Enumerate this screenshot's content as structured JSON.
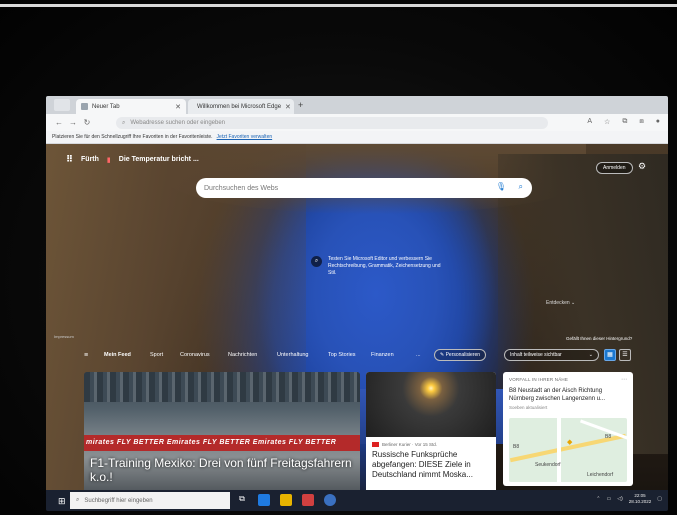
{
  "browser": {
    "tabs": [
      {
        "label": "Neuer Tab",
        "active": true
      },
      {
        "label": "Willkommen bei Microsoft Edge",
        "active": false
      }
    ],
    "address_placeholder": "Webadresse suchen oder eingeben",
    "favorites_bar_text": "Platzieren Sie für den Schnellzugriff Ihre Favoriten in der Favoritenleiste.",
    "favorites_bar_link": "Jetzt Favoriten verwalten"
  },
  "newtab": {
    "location": "Fürth",
    "weather": "Die Temperatur bricht ...",
    "signin_label": "Anmelden",
    "search_placeholder": "Durchsuchen des Webs",
    "promo_text": "Testen Sie Microsoft Editor und verbessern Sie Rechtschreibung, Grammatik, Zeichensetzung und Stil.",
    "image_caption": "Entdecken",
    "impressum": "Impressum",
    "like_bg": "Gefällt Ihnen dieser Hintergrund?"
  },
  "feed_nav": {
    "items": [
      "Mein Feed",
      "Sport",
      "Coronavirus",
      "Nachrichten",
      "Unterhaltung",
      "Top Stories",
      "Finanzen",
      "..."
    ],
    "personalize": "Personalisieren",
    "content_visibility": "Inhalt teilweise sichtbar"
  },
  "cards": {
    "main": {
      "banner": "mirates  FLY BETTER  Emirates  FLY BETTER  Emirates  FLY BETTER",
      "headline": "F1-Training Mexiko: Drei von fünf Freitagsfahrern k.o.!"
    },
    "news": {
      "source": "Berliner Kurier · Vor 15 Std.",
      "headline": "Russische Funksprüche abgefangen: DIESE Ziele in Deutschland nimmt Moska..."
    },
    "traffic": {
      "kicker": "VORFALL IN IHRER NÄHE",
      "title": "B8 Neustadt an der Aisch Richtung Nürnberg zwischen Langenzenn u...",
      "time": "Soeben aktualisiert",
      "map_labels": [
        "Seukendorf",
        "Leichendorf"
      ],
      "road_labels": [
        "B8",
        "B8"
      ]
    }
  },
  "taskbar": {
    "search_placeholder": "Suchbegriff hier eingeben",
    "clock_time": "22:05",
    "clock_date": "28.10.2022"
  },
  "colors": {
    "accent": "#1b78d0",
    "f1_banner": "#b42a2a",
    "taskbar": "#1a2130"
  }
}
